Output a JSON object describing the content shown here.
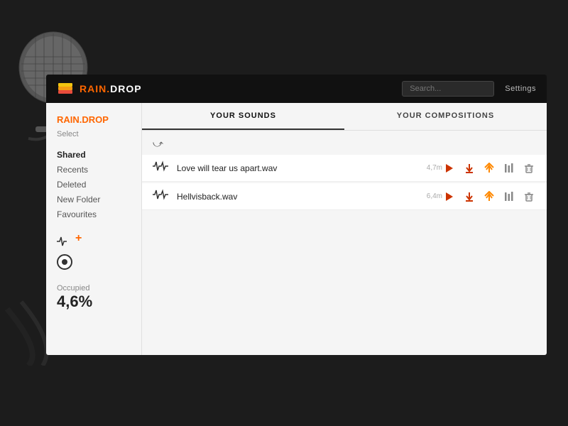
{
  "topbar": {
    "brand": "RAIN.",
    "brand_accent": "DROP",
    "search_placeholder": "Search...",
    "settings_label": "Settings"
  },
  "sidebar": {
    "brand": "RAIN.",
    "brand_accent": "DROP",
    "select_label": "Select",
    "nav_items": [
      {
        "id": "shared",
        "label": "Shared",
        "active": true
      },
      {
        "id": "recents",
        "label": "Recents",
        "active": false
      },
      {
        "id": "deleted",
        "label": "Deleted",
        "active": false
      },
      {
        "id": "new-folder",
        "label": "New Folder",
        "active": false
      },
      {
        "id": "favourites",
        "label": "Favourites",
        "active": false
      }
    ],
    "occupied_label": "Occupied",
    "occupied_value": "4,6%"
  },
  "tabs": [
    {
      "id": "sounds",
      "label": "YOUR SOUNDS",
      "active": true
    },
    {
      "id": "compositions",
      "label": "YOUR COMPOSITIONS",
      "active": false
    }
  ],
  "files": [
    {
      "id": "file-1",
      "name": "Love will tear us apart.wav",
      "duration": "4,7m"
    },
    {
      "id": "file-2",
      "name": "Hellvisback.wav",
      "duration": "6,4m"
    }
  ],
  "actions": {
    "play": "▶",
    "download": "⬇",
    "share": "⇈",
    "mixer": "|||",
    "delete": "🗑"
  }
}
